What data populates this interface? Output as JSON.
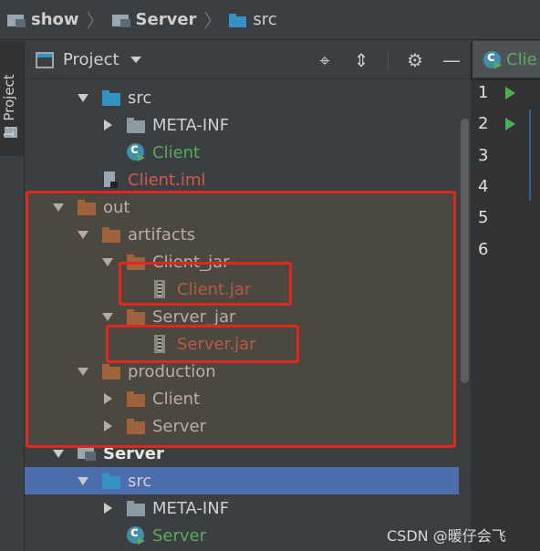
{
  "breadcrumb": {
    "items": [
      "show",
      "Server",
      "src"
    ]
  },
  "tool_window": {
    "stripe_label": "1: Project",
    "title": "Project"
  },
  "tree": {
    "rows": [
      {
        "label": "src",
        "depth": 2,
        "arrow": "down",
        "icon": "folder-blue",
        "color": "default"
      },
      {
        "label": "META-INF",
        "depth": 3,
        "arrow": "right",
        "icon": "folder-gray",
        "color": "default"
      },
      {
        "label": "Client",
        "depth": 3,
        "arrow": "none",
        "icon": "class",
        "color": "green"
      },
      {
        "label": "Client.iml",
        "depth": 2,
        "arrow": "none",
        "icon": "iml",
        "color": "red"
      },
      {
        "label": "out",
        "depth": 1,
        "arrow": "down",
        "icon": "folder-orange",
        "color": "default"
      },
      {
        "label": "artifacts",
        "depth": 2,
        "arrow": "down",
        "icon": "folder-orange",
        "color": "default"
      },
      {
        "label": "Client_jar",
        "depth": 3,
        "arrow": "down",
        "icon": "folder-orange",
        "color": "default"
      },
      {
        "label": "Client.jar",
        "depth": 4,
        "arrow": "none",
        "icon": "jar",
        "color": "red"
      },
      {
        "label": "Server_jar",
        "depth": 3,
        "arrow": "down",
        "icon": "folder-orange",
        "color": "default"
      },
      {
        "label": "Server.jar",
        "depth": 4,
        "arrow": "none",
        "icon": "jar",
        "color": "red"
      },
      {
        "label": "production",
        "depth": 2,
        "arrow": "down",
        "icon": "folder-orange",
        "color": "default"
      },
      {
        "label": "Client",
        "depth": 3,
        "arrow": "right",
        "icon": "folder-orange",
        "color": "default"
      },
      {
        "label": "Server",
        "depth": 3,
        "arrow": "right",
        "icon": "folder-orange",
        "color": "default"
      },
      {
        "label": "Server",
        "depth": 1,
        "arrow": "down",
        "icon": "module",
        "color": "bold"
      },
      {
        "label": "src",
        "depth": 2,
        "arrow": "down",
        "icon": "folder-blue",
        "color": "default",
        "selected": true
      },
      {
        "label": "META-INF",
        "depth": 3,
        "arrow": "right",
        "icon": "folder-gray",
        "color": "default"
      },
      {
        "label": "Server",
        "depth": 3,
        "arrow": "none",
        "icon": "class",
        "color": "green"
      }
    ]
  },
  "editor": {
    "tab_label": "Clie",
    "line_numbers": [
      "1",
      "2",
      "3",
      "4",
      "5",
      "6"
    ],
    "run_markers_on_lines": [
      1,
      2
    ]
  },
  "watermark": "CSDN @暖仔会飞",
  "colors": {
    "selection": "#4b6eaf",
    "highlight_box": "#e0261f",
    "class_name_green": "#5ea85e",
    "excluded_red": "#d05a4e"
  }
}
